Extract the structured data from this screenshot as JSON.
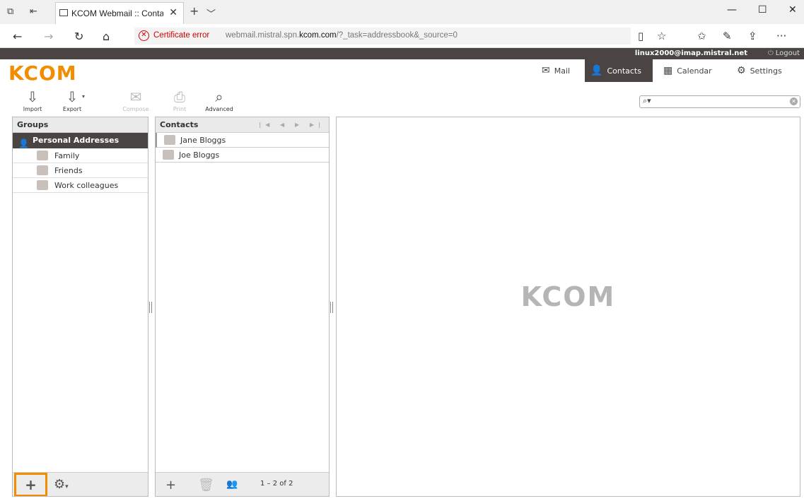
{
  "browser": {
    "tab_title": "KCOM Webmail :: Conta",
    "tab_close": "✕",
    "new_tab": "+",
    "tab_menu": "﹀",
    "cert_error": "Certificate error",
    "url_prefix": "webmail.mistral.spn.",
    "url_domain": "kcom.com",
    "url_suffix": "/?_task=addressbook&_source=0"
  },
  "topline": {
    "user": "linux2000@imap.mistral.net",
    "logout": "Logout"
  },
  "header": {
    "logo": "KCOM",
    "tabs": [
      {
        "label": "Mail"
      },
      {
        "label": "Contacts"
      },
      {
        "label": "Calendar"
      },
      {
        "label": "Settings"
      }
    ]
  },
  "toolbar": {
    "import": "Import",
    "export": "Export",
    "compose": "Compose",
    "print": "Print",
    "advanced": "Advanced",
    "search_placeholder": ""
  },
  "groups": {
    "title": "Groups",
    "root": "Personal Addresses",
    "items": [
      "Family",
      "Friends",
      "Work colleagues"
    ]
  },
  "contacts": {
    "title": "Contacts",
    "items": [
      "Jane Bloggs",
      "Joe Bloggs"
    ],
    "count": "1 – 2 of 2"
  },
  "details": {
    "watermark": "KCOM"
  },
  "colors": {
    "accent": "#f28c00",
    "dark": "#4a4443"
  }
}
